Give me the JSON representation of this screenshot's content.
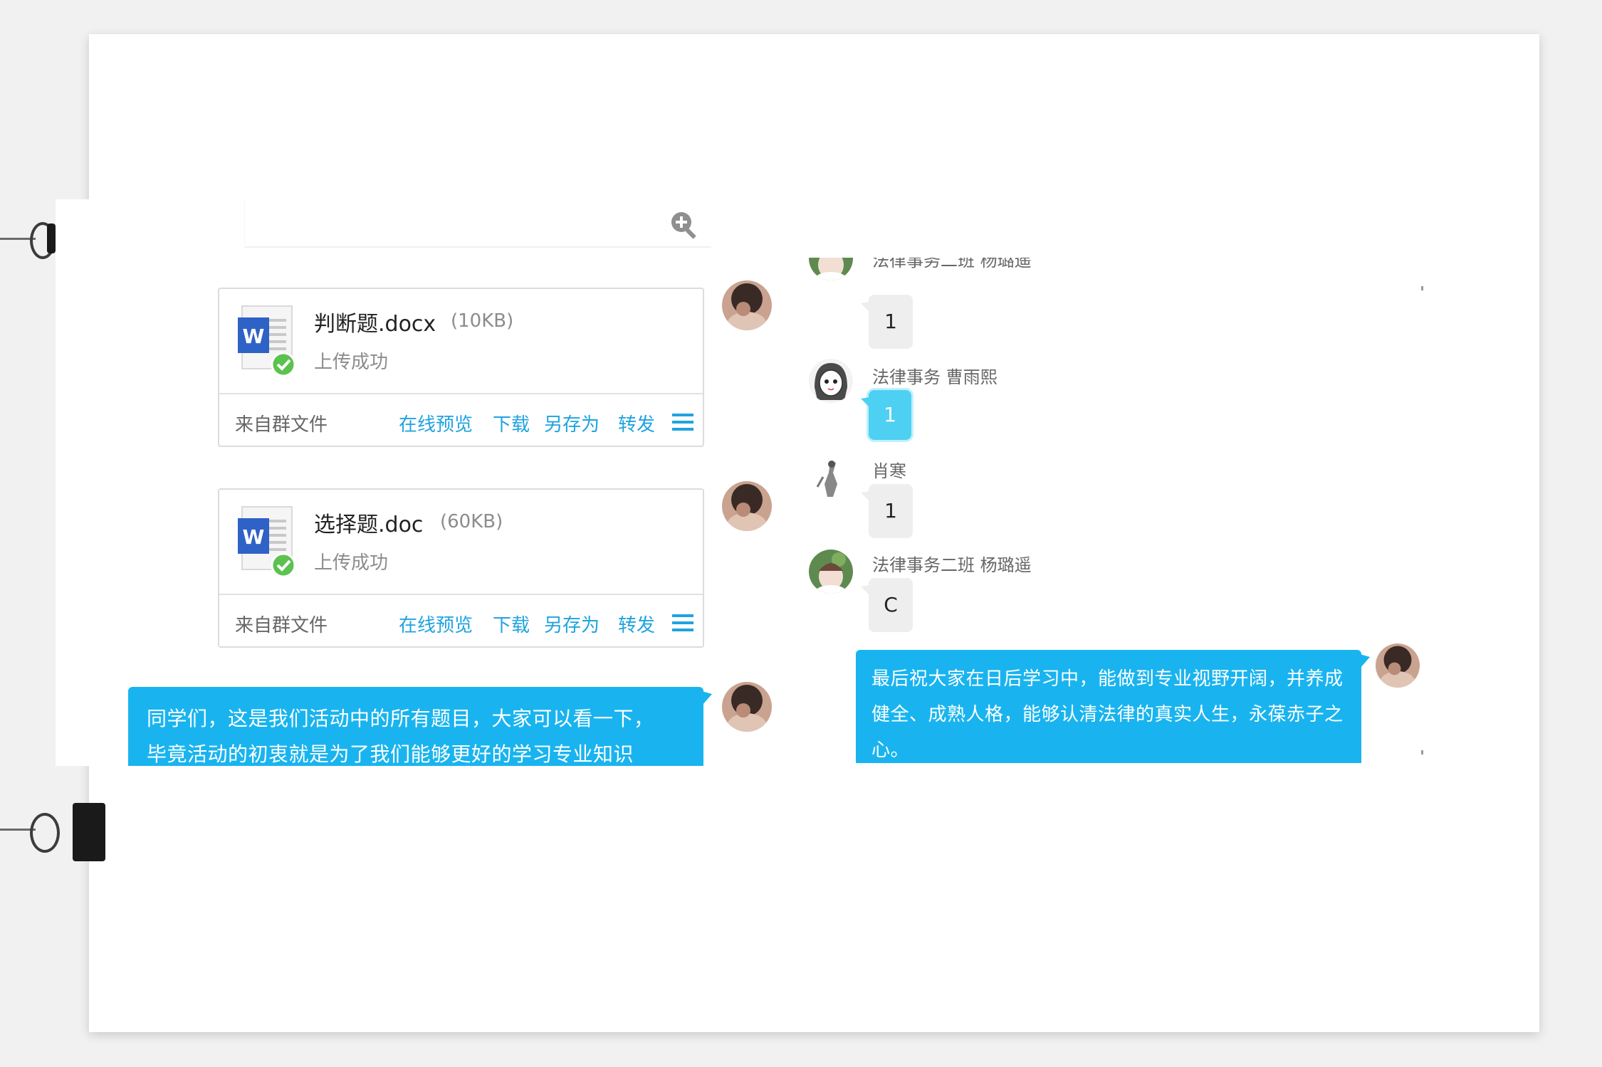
{
  "search": {
    "placeholder": ""
  },
  "files": [
    {
      "name": "判断题.docx",
      "size": "(10KB)",
      "status": "上传成功",
      "source": "来自群文件",
      "actions": [
        "在线预览",
        "下载",
        "另存为",
        "转发"
      ]
    },
    {
      "name": "选择题.doc",
      "size": "(60KB)",
      "status": "上传成功",
      "source": "来自群文件",
      "actions": [
        "在线预览",
        "下载",
        "另存为",
        "转发"
      ]
    }
  ],
  "left_message": {
    "line1": "同学们，这是我们活动中的所有题目，大家可以看一下，",
    "line2": "毕竟活动的初衷就是为了我们能够更好的学习专业知识"
  },
  "group_chat": [
    {
      "sender": "法律事务二班 杨璐遥",
      "text": "1"
    },
    {
      "sender": "法律事务 曹雨熙",
      "text": "1"
    },
    {
      "sender": "肖寒",
      "text": "1"
    },
    {
      "sender": "法律事务二班 杨璐遥",
      "text": "C"
    }
  ],
  "closing_message": {
    "line1": "最后祝大家在日后学习中，能做到专业视野开阔，并养成",
    "line2": "健全、成熟人格，能够认清法律的真实人生，永葆赤子之",
    "line3": "心。"
  },
  "icons": {
    "search": "zoom-in-icon",
    "file": "word-document-icon",
    "status": "check-circle-icon",
    "menu": "hamburger-menu-icon"
  },
  "colors": {
    "accent": "#1fa3e0",
    "bubble_out": "#19b4ef",
    "bubble_in": "#eeeeee",
    "highlight": "#4ed0f3",
    "success": "#5cc24f",
    "word_blue": "#2f62c6"
  }
}
